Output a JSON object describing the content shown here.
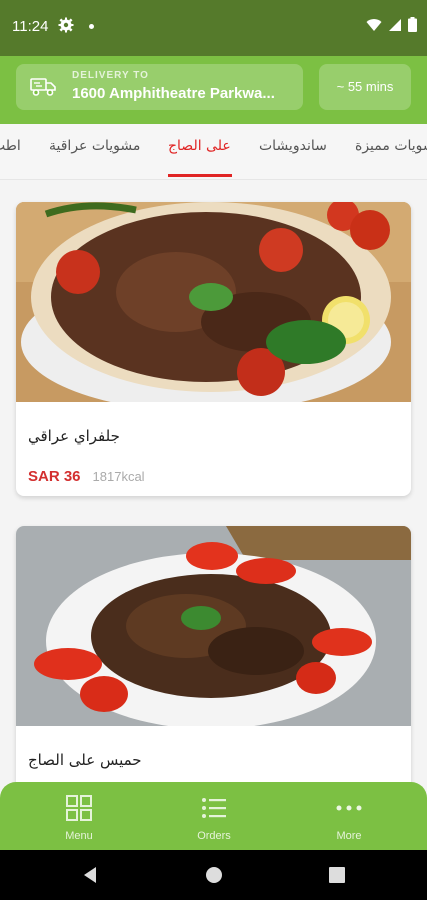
{
  "status_bar": {
    "time": "11:24"
  },
  "header": {
    "delivery_caption": "DELIVERY TO",
    "address": "1600 Amphitheatre Parkwa...",
    "eta": "~ 55 mins",
    "icons": [
      "truck-icon"
    ]
  },
  "tabs": [
    {
      "label": "اطب"
    },
    {
      "label": "مشويات عراقية"
    },
    {
      "label": "على الصاج",
      "active": true
    },
    {
      "label": "ساندويشات"
    },
    {
      "label": "مشويات مميزة"
    }
  ],
  "menu_items": [
    {
      "name": "جلفراي عراقي",
      "price": "SAR 36",
      "kcal": "1817kcal"
    },
    {
      "name": "حميس على الصاج"
    }
  ],
  "bottom_nav": {
    "items": [
      {
        "label": "Menu",
        "icon": "grid-icon"
      },
      {
        "label": "Orders",
        "icon": "list-icon"
      },
      {
        "label": "More",
        "icon": "more-dots-icon"
      }
    ]
  },
  "colors": {
    "status_bar": "#557a2b",
    "brand_green": "#7cc043",
    "accent_red": "#e02424",
    "price_red": "#d32f2f"
  }
}
